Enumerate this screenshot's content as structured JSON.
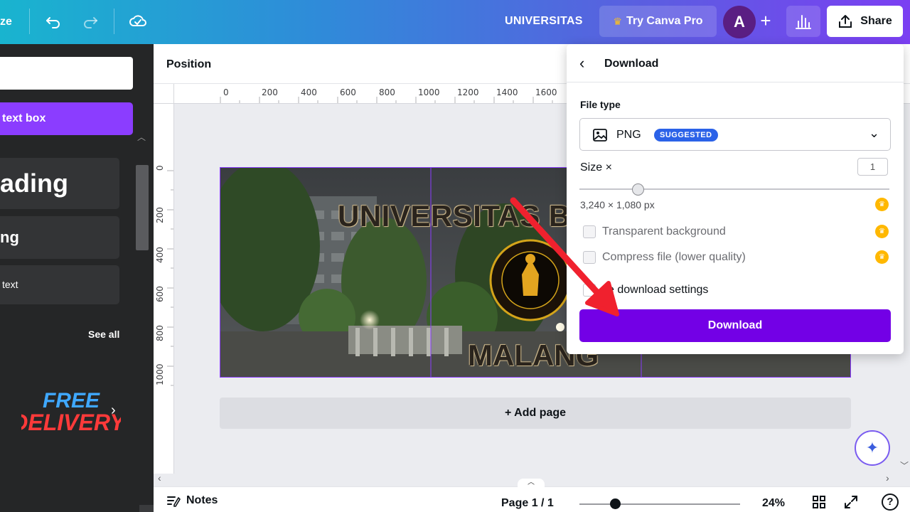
{
  "topbar": {
    "resize_label": "ze",
    "title": "UNIVERSITAS",
    "try_pro_label": "Try Canva Pro",
    "avatar_initial": "A",
    "plus_label": "+",
    "share_label": "Share"
  },
  "left_panel": {
    "add_text_box_label": "text box",
    "heading_label": "ading",
    "subheading_label": "ng",
    "body_text_label": "text",
    "see_all_label": "See all",
    "promo": {
      "line1": "FREE",
      "line2": "DELIVERY"
    }
  },
  "context_toolbar": {
    "position_label": "Position"
  },
  "ruler": {
    "h_ticks": [
      "0",
      "200",
      "400",
      "600",
      "800",
      "1000",
      "1200",
      "1400",
      "1600"
    ],
    "v_ticks": [
      "0",
      "200",
      "400",
      "600",
      "800",
      "1000"
    ]
  },
  "canvas": {
    "title_top": "UNIVERSITAS B",
    "title_bottom": "MALANG",
    "seal_text": "UNIVERSITAS BRAWIJAYA"
  },
  "add_page_label": "+ Add page",
  "bottombar": {
    "notes_label": "Notes",
    "page_label": "Page 1 / 1",
    "zoom_label": "24%",
    "help_label": "?"
  },
  "download_panel": {
    "title": "Download",
    "file_type_label": "File type",
    "file_type_value": "PNG",
    "suggested_badge": "SUGGESTED",
    "size_label": "Size ×",
    "size_value": "1",
    "dimensions": "3,240 × 1,080 px",
    "option_transparent": "Transparent background",
    "option_compress": "Compress file (lower quality)",
    "save_settings_label": "ve download settings",
    "download_button_label": "Download"
  },
  "colors": {
    "accent_purple": "#8b3dff",
    "download_button": "#7300e6",
    "badge_blue": "#2b62e8",
    "crown_gold": "#ffb800",
    "annotation_arrow": "#f0212e"
  }
}
